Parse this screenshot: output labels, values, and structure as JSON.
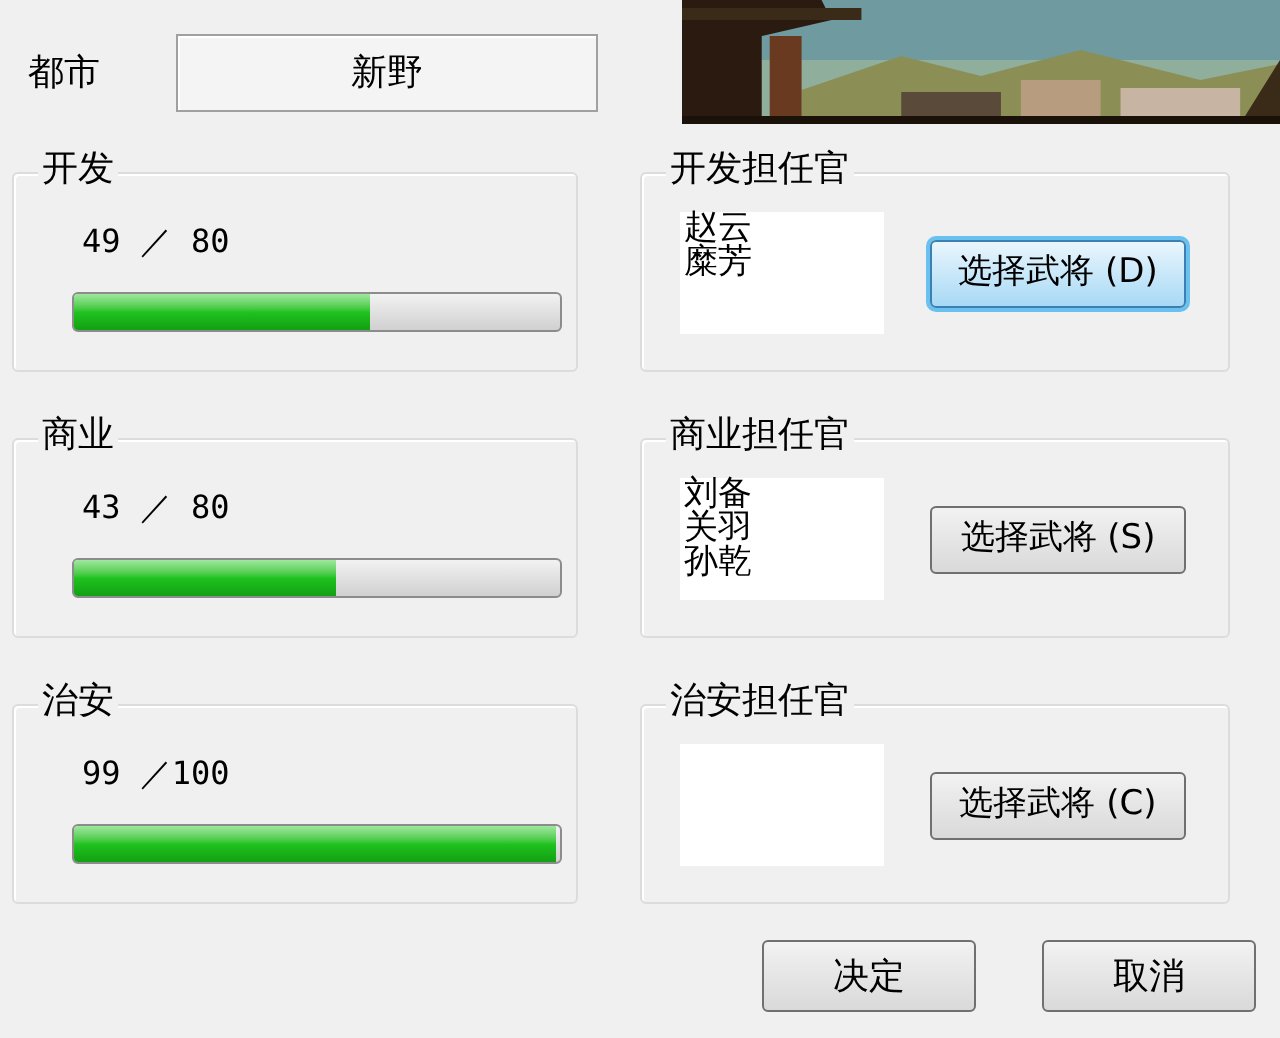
{
  "city": {
    "label": "都市",
    "value": "新野"
  },
  "sections": [
    {
      "title": "开发",
      "reading": "49 ／ 80",
      "level": 0.61,
      "officer_title": "开发担任官",
      "officers": [
        "赵云",
        "糜芳"
      ],
      "button": "选择武将 (D)",
      "focused": true
    },
    {
      "title": "商业",
      "reading": "43 ／ 80",
      "level": 0.54,
      "officer_title": "商业担任官",
      "officers": [
        "刘备",
        "关羽",
        "孙乾"
      ],
      "button": "选择武将 (S)",
      "focused": false
    },
    {
      "title": "治安",
      "reading": "99 ／100",
      "level": 0.99,
      "officer_title": "治安担任官",
      "button": "选择武将 (C)",
      "focused": false
    }
  ],
  "buttons": [
    "决定",
    "取消"
  ]
}
